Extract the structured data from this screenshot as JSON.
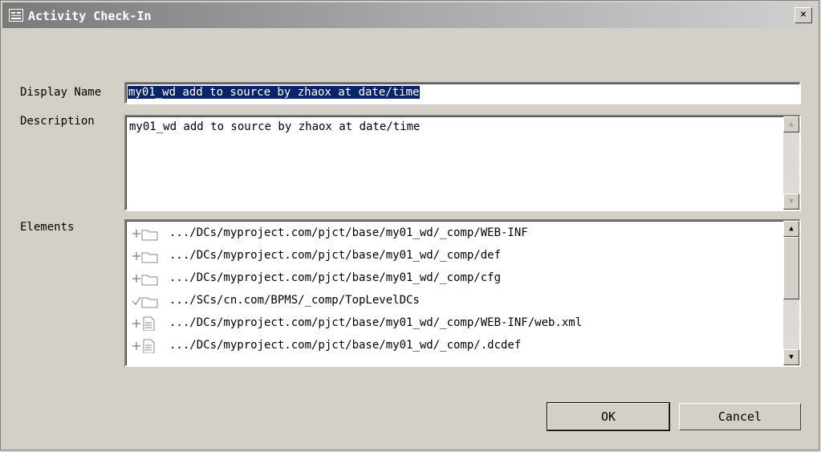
{
  "window": {
    "title": "Activity Check-In",
    "close_label": "×"
  },
  "form": {
    "display_name_label": "Display Name",
    "display_name_value": "my01_wd add to source by zhaox at date/time",
    "description_label": "Description",
    "description_value": "my01_wd add to source by zhaox at date/time",
    "elements_label": "Elements"
  },
  "elements": [
    {
      "path": ".../DCs/myproject.com/pjct/base/my01_wd/_comp/WEB-INF",
      "icon": "folder-add-icon"
    },
    {
      "path": ".../DCs/myproject.com/pjct/base/my01_wd/_comp/def",
      "icon": "folder-add-icon"
    },
    {
      "path": ".../DCs/myproject.com/pjct/base/my01_wd/_comp/cfg",
      "icon": "folder-add-icon"
    },
    {
      "path": ".../SCs/cn.com/BPMS/_comp/TopLevelDCs",
      "icon": "folder-check-icon"
    },
    {
      "path": ".../DCs/myproject.com/pjct/base/my01_wd/_comp/WEB-INF/web.xml",
      "icon": "file-add-icon"
    },
    {
      "path": ".../DCs/myproject.com/pjct/base/my01_wd/_comp/.dcdef",
      "icon": "file-add-icon"
    }
  ],
  "buttons": {
    "ok": "OK",
    "cancel": "Cancel"
  }
}
